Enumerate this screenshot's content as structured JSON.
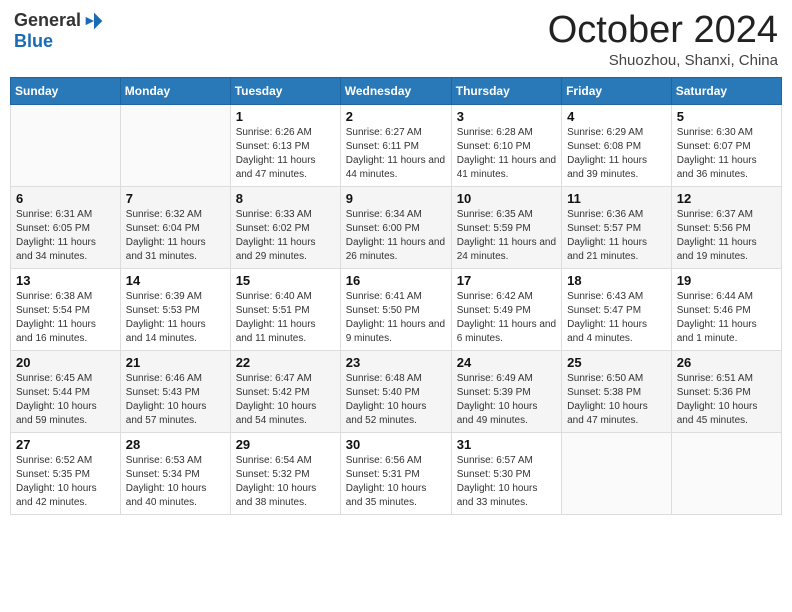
{
  "logo": {
    "general": "General",
    "blue": "Blue"
  },
  "title": "October 2024",
  "location": "Shuozhou, Shanxi, China",
  "days_of_week": [
    "Sunday",
    "Monday",
    "Tuesday",
    "Wednesday",
    "Thursday",
    "Friday",
    "Saturday"
  ],
  "weeks": [
    [
      {
        "day": "",
        "info": ""
      },
      {
        "day": "",
        "info": ""
      },
      {
        "day": "1",
        "sunrise": "6:26 AM",
        "sunset": "6:13 PM",
        "daylight": "11 hours and 47 minutes."
      },
      {
        "day": "2",
        "sunrise": "6:27 AM",
        "sunset": "6:11 PM",
        "daylight": "11 hours and 44 minutes."
      },
      {
        "day": "3",
        "sunrise": "6:28 AM",
        "sunset": "6:10 PM",
        "daylight": "11 hours and 41 minutes."
      },
      {
        "day": "4",
        "sunrise": "6:29 AM",
        "sunset": "6:08 PM",
        "daylight": "11 hours and 39 minutes."
      },
      {
        "day": "5",
        "sunrise": "6:30 AM",
        "sunset": "6:07 PM",
        "daylight": "11 hours and 36 minutes."
      }
    ],
    [
      {
        "day": "6",
        "sunrise": "6:31 AM",
        "sunset": "6:05 PM",
        "daylight": "11 hours and 34 minutes."
      },
      {
        "day": "7",
        "sunrise": "6:32 AM",
        "sunset": "6:04 PM",
        "daylight": "11 hours and 31 minutes."
      },
      {
        "day": "8",
        "sunrise": "6:33 AM",
        "sunset": "6:02 PM",
        "daylight": "11 hours and 29 minutes."
      },
      {
        "day": "9",
        "sunrise": "6:34 AM",
        "sunset": "6:00 PM",
        "daylight": "11 hours and 26 minutes."
      },
      {
        "day": "10",
        "sunrise": "6:35 AM",
        "sunset": "5:59 PM",
        "daylight": "11 hours and 24 minutes."
      },
      {
        "day": "11",
        "sunrise": "6:36 AM",
        "sunset": "5:57 PM",
        "daylight": "11 hours and 21 minutes."
      },
      {
        "day": "12",
        "sunrise": "6:37 AM",
        "sunset": "5:56 PM",
        "daylight": "11 hours and 19 minutes."
      }
    ],
    [
      {
        "day": "13",
        "sunrise": "6:38 AM",
        "sunset": "5:54 PM",
        "daylight": "11 hours and 16 minutes."
      },
      {
        "day": "14",
        "sunrise": "6:39 AM",
        "sunset": "5:53 PM",
        "daylight": "11 hours and 14 minutes."
      },
      {
        "day": "15",
        "sunrise": "6:40 AM",
        "sunset": "5:51 PM",
        "daylight": "11 hours and 11 minutes."
      },
      {
        "day": "16",
        "sunrise": "6:41 AM",
        "sunset": "5:50 PM",
        "daylight": "11 hours and 9 minutes."
      },
      {
        "day": "17",
        "sunrise": "6:42 AM",
        "sunset": "5:49 PM",
        "daylight": "11 hours and 6 minutes."
      },
      {
        "day": "18",
        "sunrise": "6:43 AM",
        "sunset": "5:47 PM",
        "daylight": "11 hours and 4 minutes."
      },
      {
        "day": "19",
        "sunrise": "6:44 AM",
        "sunset": "5:46 PM",
        "daylight": "11 hours and 1 minute."
      }
    ],
    [
      {
        "day": "20",
        "sunrise": "6:45 AM",
        "sunset": "5:44 PM",
        "daylight": "10 hours and 59 minutes."
      },
      {
        "day": "21",
        "sunrise": "6:46 AM",
        "sunset": "5:43 PM",
        "daylight": "10 hours and 57 minutes."
      },
      {
        "day": "22",
        "sunrise": "6:47 AM",
        "sunset": "5:42 PM",
        "daylight": "10 hours and 54 minutes."
      },
      {
        "day": "23",
        "sunrise": "6:48 AM",
        "sunset": "5:40 PM",
        "daylight": "10 hours and 52 minutes."
      },
      {
        "day": "24",
        "sunrise": "6:49 AM",
        "sunset": "5:39 PM",
        "daylight": "10 hours and 49 minutes."
      },
      {
        "day": "25",
        "sunrise": "6:50 AM",
        "sunset": "5:38 PM",
        "daylight": "10 hours and 47 minutes."
      },
      {
        "day": "26",
        "sunrise": "6:51 AM",
        "sunset": "5:36 PM",
        "daylight": "10 hours and 45 minutes."
      }
    ],
    [
      {
        "day": "27",
        "sunrise": "6:52 AM",
        "sunset": "5:35 PM",
        "daylight": "10 hours and 42 minutes."
      },
      {
        "day": "28",
        "sunrise": "6:53 AM",
        "sunset": "5:34 PM",
        "daylight": "10 hours and 40 minutes."
      },
      {
        "day": "29",
        "sunrise": "6:54 AM",
        "sunset": "5:32 PM",
        "daylight": "10 hours and 38 minutes."
      },
      {
        "day": "30",
        "sunrise": "6:56 AM",
        "sunset": "5:31 PM",
        "daylight": "10 hours and 35 minutes."
      },
      {
        "day": "31",
        "sunrise": "6:57 AM",
        "sunset": "5:30 PM",
        "daylight": "10 hours and 33 minutes."
      },
      {
        "day": "",
        "info": ""
      },
      {
        "day": "",
        "info": ""
      }
    ]
  ]
}
